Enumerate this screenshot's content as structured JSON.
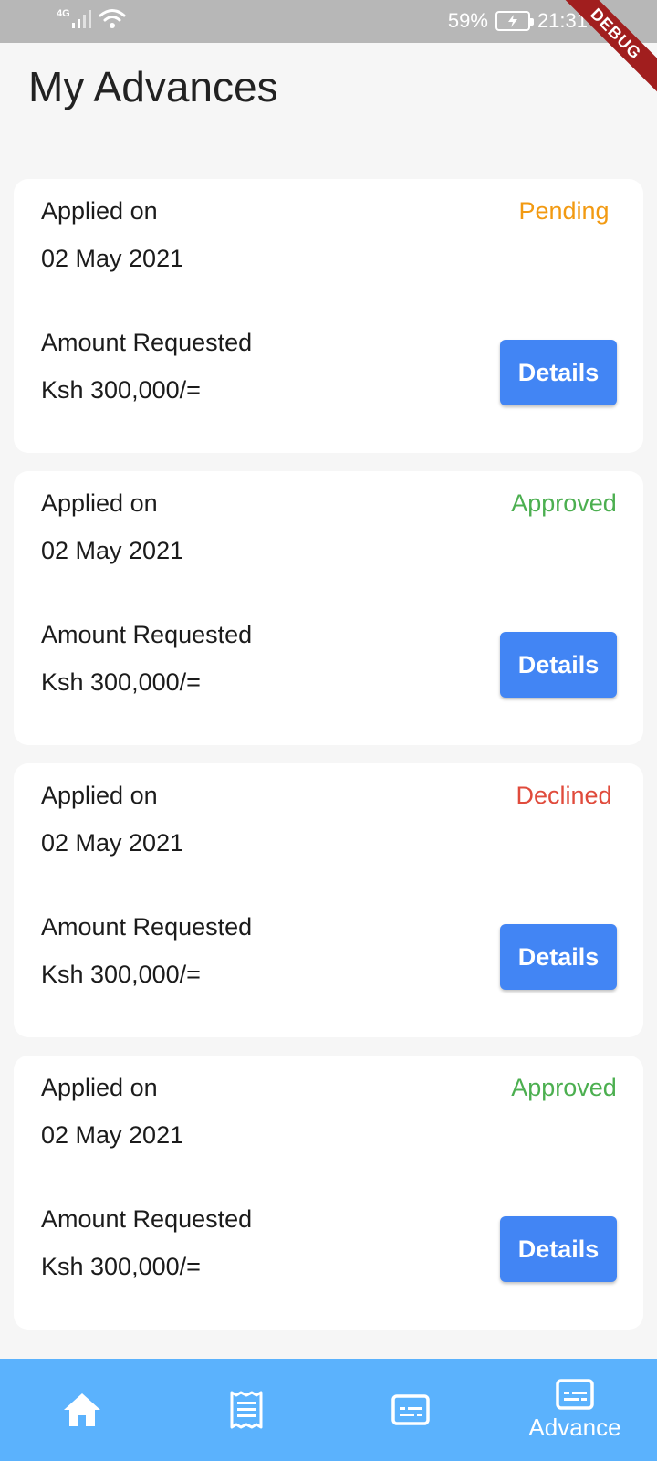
{
  "status_bar": {
    "network": "4G",
    "battery": "59%",
    "time": "21:31",
    "debug_banner": "DEBUG"
  },
  "page": {
    "title": "My Advances"
  },
  "advances": [
    {
      "applied_label": "Applied on",
      "applied_date": "02 May 2021",
      "status": "Pending",
      "status_color": "#f29a12",
      "amount_label": "Amount Requested",
      "amount": "Ksh 300,000/=",
      "details_label": "Details"
    },
    {
      "applied_label": "Applied on",
      "applied_date": "02 May 2021",
      "status": "Approved",
      "status_color": "#4caf50",
      "amount_label": "Amount Requested",
      "amount": "Ksh 300,000/=",
      "details_label": "Details"
    },
    {
      "applied_label": "Applied on",
      "applied_date": "02 May 2021",
      "status": "Declined",
      "status_color": "#e04b3c",
      "amount_label": "Amount Requested",
      "amount": "Ksh 300,000/=",
      "details_label": "Details"
    },
    {
      "applied_label": "Applied on",
      "applied_date": "02 May 2021",
      "status": "Approved",
      "status_color": "#4caf50",
      "amount_label": "Amount Requested",
      "amount": "Ksh 300,000/=",
      "details_label": "Details"
    }
  ],
  "bottom_nav": {
    "items": [
      {
        "icon": "home-icon",
        "label": ""
      },
      {
        "icon": "receipt-icon",
        "label": ""
      },
      {
        "icon": "card-icon",
        "label": ""
      },
      {
        "icon": "card-icon",
        "label": "Advance",
        "active": true
      }
    ]
  },
  "colors": {
    "accent_button": "#4285f4",
    "nav_background": "#5bb2fd",
    "status_bar": "#b7b7b7"
  }
}
